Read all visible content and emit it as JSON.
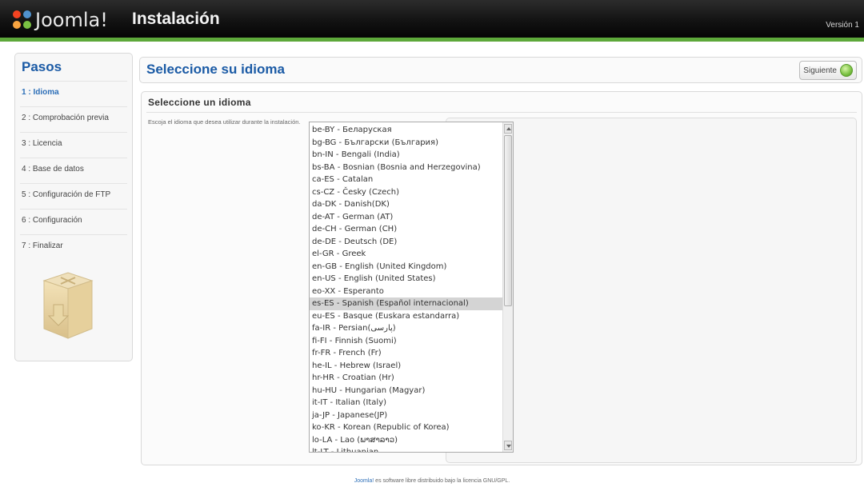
{
  "header": {
    "logo_text": "Joomla!",
    "title": "Instalación",
    "version": "Versión 1"
  },
  "steps": {
    "title": "Pasos",
    "items": [
      {
        "label": "1 : Idioma",
        "active": true
      },
      {
        "label": "2 : Comprobación previa",
        "active": false
      },
      {
        "label": "3 : Licencia",
        "active": false
      },
      {
        "label": "4 : Base de datos",
        "active": false
      },
      {
        "label": "5 : Configuración de FTP",
        "active": false
      },
      {
        "label": "6 : Configuración",
        "active": false
      },
      {
        "label": "7 : Finalizar",
        "active": false
      }
    ]
  },
  "main": {
    "title": "Seleccione su idioma",
    "next_label": "Siguiente",
    "section_title": "Seleccione un idioma",
    "instruction": "Escoja el idioma que desea utilizar durante la instalación.",
    "languages": [
      "be-BY - Беларуская",
      "bg-BG - Български (България)",
      "bn-IN - Bengali (India)",
      "bs-BA - Bosnian (Bosnia and Herzegovina)",
      "ca-ES - Catalan",
      "cs-CZ - Česky (Czech)",
      "da-DK - Danish(DK)",
      "de-AT - German (AT)",
      "de-CH - German (CH)",
      "de-DE - Deutsch (DE)",
      "el-GR - Greek",
      "en-GB - English (United Kingdom)",
      "en-US - English (United States)",
      "eo-XX - Esperanto",
      "es-ES - Spanish (Español internacional)",
      "eu-ES - Basque (Euskara estandarra)",
      "fa-IR - Persian(پارسی)",
      "fi-FI - Finnish (Suomi)",
      "fr-FR - French (Fr)",
      "he-IL - Hebrew (Israel)",
      "hr-HR - Croatian (Hr)",
      "hu-HU - Hungarian (Magyar)",
      "it-IT - Italian (Italy)",
      "ja-JP - Japanese(JP)",
      "ko-KR - Korean (Republic of Korea)",
      "lo-LA - Lao (ພາສາລາວ)",
      "lt-LT - Lithuanian"
    ],
    "selected_language": "es-ES - Spanish (Español internacional)"
  },
  "footer": {
    "link_text": "Joomla!",
    "text": " es software libre distribuido bajo la licencia GNU/GPL."
  },
  "colors": {
    "accent_green": "#5da83a",
    "title_blue": "#1a5aa5",
    "header_dark": "#111111"
  }
}
